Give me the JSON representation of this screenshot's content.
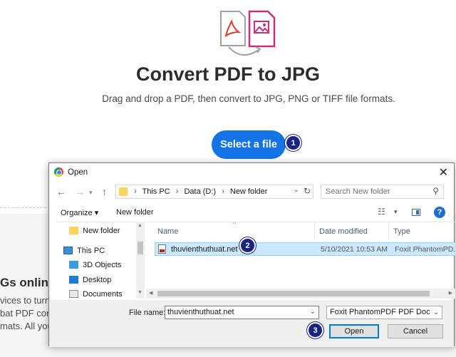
{
  "page": {
    "title": "Convert PDF to JPG",
    "subtitle": "Drag and drop a PDF, then convert to JPG, PNG or TIFF file formats.",
    "select_button": "Select a file",
    "bg_heading_fragment": "Gs online",
    "bg_lines": [
      "vices to turn",
      "bat PDF con",
      "mats. All you"
    ]
  },
  "badges": [
    "1",
    "2",
    "3"
  ],
  "dialog": {
    "title": "Open",
    "close_glyph": "✕",
    "breadcrumbs": [
      "This PC",
      "Data (D:)",
      "New folder"
    ],
    "search_placeholder": "Search New folder",
    "toolbar": {
      "organize": "Organize ▾",
      "new_folder": "New folder"
    },
    "nav_items": [
      "New folder",
      "This PC",
      "3D Objects",
      "Desktop",
      "Documents"
    ],
    "columns": {
      "name": "Name",
      "date": "Date modified",
      "type": "Type"
    },
    "file": {
      "name": "thuvienthuthuat.net",
      "date": "5/10/2021 10:53 AM",
      "type": "Foxit PhantomPD..."
    },
    "file_name_label": "File name:",
    "file_name_value": "thuvienthuthuat.net",
    "file_type_value": "Foxit PhantomPDF PDF Docum",
    "open_button": "Open",
    "cancel_button": "Cancel"
  },
  "colors": {
    "accent": "#1473e6",
    "badge": "#1a237e",
    "selection": "#cce8ff"
  }
}
